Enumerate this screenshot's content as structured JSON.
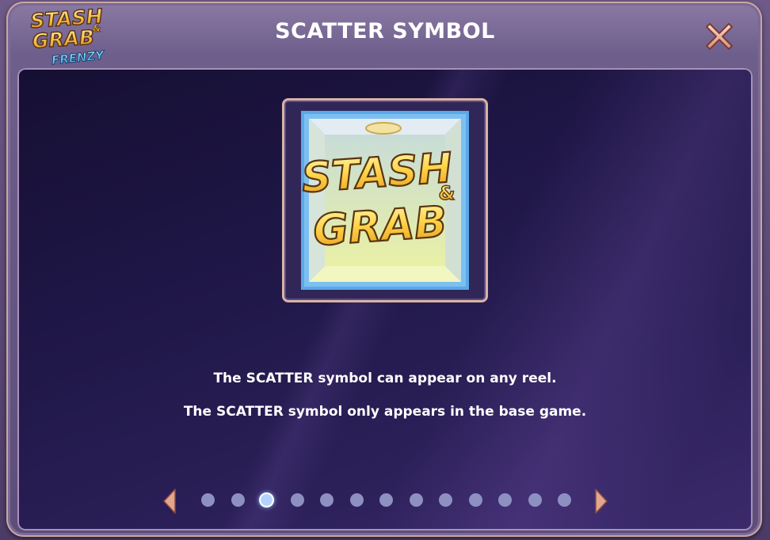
{
  "header": {
    "title": "SCATTER SYMBOL",
    "logo_text": [
      "STASH",
      "&",
      "GRAB",
      "FRENZY"
    ]
  },
  "symbol": {
    "name": "scatter-symbol",
    "text": [
      "STASH",
      "&",
      "GRAB"
    ]
  },
  "description": {
    "line1": "The SCATTER symbol can appear on any reel.",
    "line2": "The SCATTER symbol only appears in the base game."
  },
  "pagination": {
    "total_pages": 13,
    "current_page": 3
  },
  "colors": {
    "accent_gold": "#f5c542",
    "panel_dark": "#1e1645",
    "dot_inactive": "#8e90c2",
    "dot_active": "#b5d2ff",
    "nav_arrow": "#e3a78f"
  }
}
